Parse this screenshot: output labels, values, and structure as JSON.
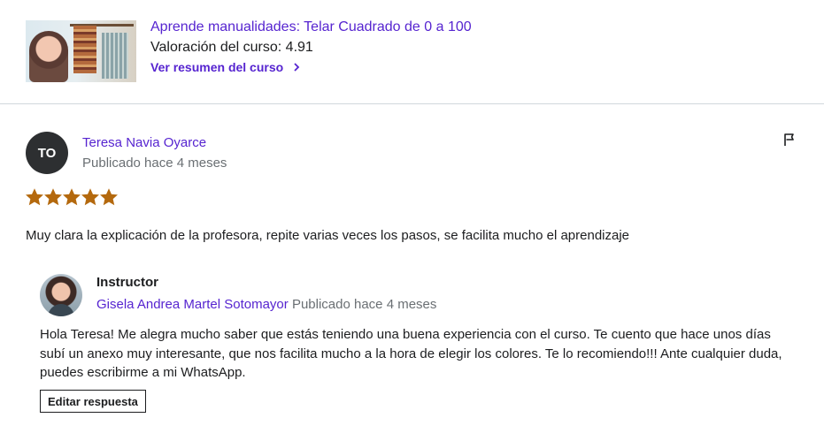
{
  "course": {
    "title": "Aprende manualidades: Telar Cuadrado de 0 a 100",
    "rating_text": "Valoración del curso: 4.91",
    "summary_link": "Ver resumen del curso"
  },
  "review": {
    "avatar_initials": "TO",
    "reviewer_name": "Teresa Navia Oyarce",
    "date": "Publicado hace 4 meses",
    "rating": 5,
    "max_rating": 5,
    "text": "Muy clara la explicación de la profesora, repite varias veces los pasos, se facilita mucho el aprendizaje"
  },
  "response": {
    "heading": "Instructor",
    "instructor_name": "Gisela Andrea Martel Sotomayor",
    "date": "Publicado hace 4 meses",
    "text": "Hola Teresa! Me alegra mucho saber que estás teniendo una buena experiencia con el curso. Te cuento que hace unos días subí un anexo muy interesante, que nos facilita mucho a la hora de elegir los colores. Te lo recomiendo!!! Ante cualquier duda, puedes escribirme a mi WhatsApp.",
    "edit_button": "Editar respuesta"
  },
  "colors": {
    "accent": "#5624d0",
    "star": "#b4690e",
    "muted": "#6a6f73"
  },
  "icons": [
    "chevron-right-icon",
    "flag-icon",
    "star-icon"
  ]
}
